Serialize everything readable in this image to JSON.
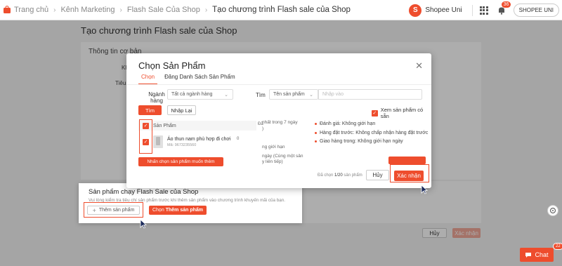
{
  "topbar": {
    "breadcrumb": [
      "Trang chủ",
      "Kênh Marketing",
      "Flash Sale Của Shop",
      "Tạo chương trình Flash sale của Shop"
    ],
    "uni_label": "Shopee Uni",
    "notif_count": "36",
    "shop_button": "SHOPEE UNI"
  },
  "page": {
    "title": "Tạo chương trình Flash sale của Shop",
    "basic_info": "Thông tin cơ bản",
    "row1_label": "Khun",
    "row2_label": "Tiêu chí",
    "cancel": "Hủy",
    "confirm": "Xác nhận"
  },
  "modal": {
    "title": "Chọn Sản Phẩm",
    "tabs": [
      "Chọn",
      "Đăng Danh Sách Sản Phẩm"
    ],
    "category_label": "Ngành hàng",
    "category_value": "Tất cả ngành hàng",
    "search_label": "Tìm",
    "search_type": "Tên sản phẩm",
    "search_placeholder": "Nhập vào",
    "search_button": "Tìm",
    "reset_button": "Nhập Lại",
    "show_eligible": "Xem sản phẩm có sẵn",
    "col_product": "Sản Phẩm",
    "product_name": "Áo thun nam phù hợp đi chơi",
    "product_sku": "Mã: 9673235560",
    "cell_a": "Đã",
    "cell_b": "0",
    "mid_lines": [
      "nhất trong 7 ngày",
      ")",
      "ng giới hạn",
      "ngày (Cùng một sản",
      "y liên tiếp)"
    ],
    "criteria": [
      "Đánh giá: Không giới hạn",
      "Hàng đặt trước: Không chấp nhận hàng đặt trước",
      "Giao hàng trong: Không giới hạn ngày"
    ],
    "choose_btn": "Nhấn chọn sản phẩm muốn thêm",
    "selected_prefix": "Đã chọn ",
    "selected_count": "1/20",
    "selected_suffix": " sản phẩm",
    "cancel": "Hủy",
    "confirm": "Xác nhận"
  },
  "flash_section": {
    "title": "Sản phẩm chạy Flash Sale của Shop",
    "desc": "Vui lòng kiểm tra tiêu chí sản phẩm trước khi thêm sản phẩm vào chương trình khuyến mãi của bạn.",
    "add_button": "Thêm sản phẩm",
    "choose_prefix": "Chọn",
    "choose_bold": "Thêm sản phẩm"
  },
  "chat": {
    "label": "Chat",
    "count": "22"
  },
  "colors": {
    "accent": "#ee4d2d"
  }
}
